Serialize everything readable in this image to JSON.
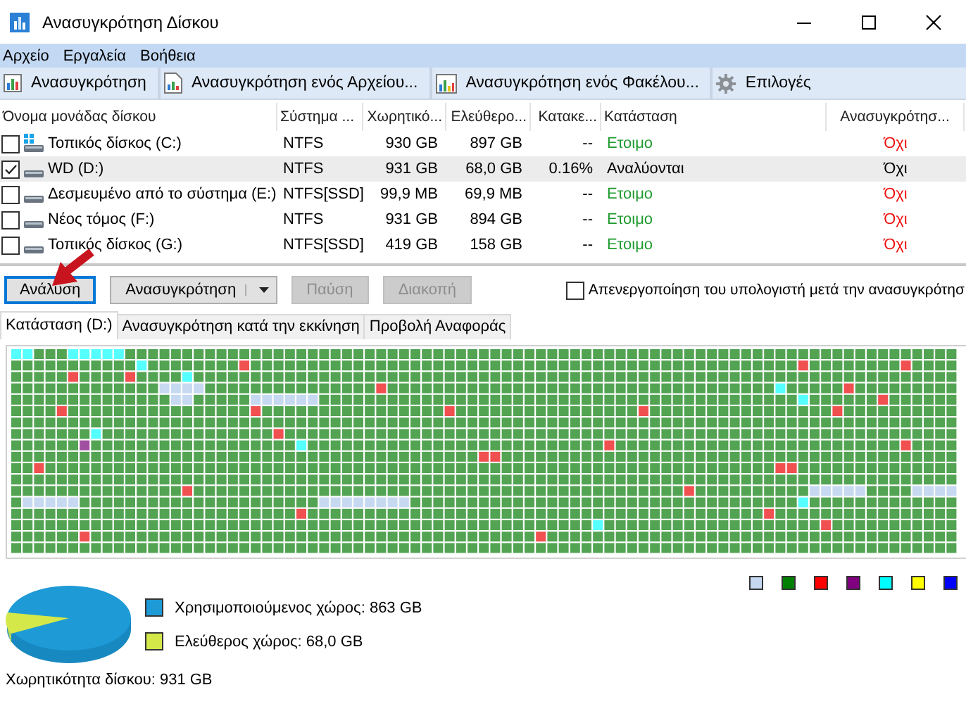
{
  "window": {
    "title": "Ανασυγκρότηση Δίσκου"
  },
  "menu": [
    "Αρχείο",
    "Εργαλεία",
    "Βοήθεια"
  ],
  "toolbar": [
    {
      "label": "Ανασυγκρότηση",
      "kind": "defrag"
    },
    {
      "label": "Ανασυγκρότηση ενός Αρχείου...",
      "kind": "file"
    },
    {
      "label": "Ανασυγκρότηση ενός Φακέλου...",
      "kind": "folder"
    },
    {
      "label": "Επιλογές",
      "kind": "options"
    }
  ],
  "drive_table": {
    "columns": [
      "Όνομα μονάδας δίσκου",
      "Σύστημα ...",
      "Χωρητικό...",
      "Ελεύθερο...",
      "Κατακε...",
      "Κατάσταση",
      "Ανασυγκρότησ..."
    ],
    "rows": [
      {
        "name": "Τοπικός δίσκος (C:)",
        "kind": "system",
        "checked": false,
        "selected": false,
        "file_system": "NTFS",
        "capacity": "930 GB",
        "free": "897 GB",
        "fragmented": "--",
        "status": {
          "text": "Ετοιμο",
          "kind": "ready"
        },
        "defrag": "Όχι"
      },
      {
        "name": "WD (D:)",
        "kind": "drive",
        "checked": true,
        "selected": true,
        "file_system": "NTFS",
        "capacity": "931 GB",
        "free": "68,0 GB",
        "fragmented": "0.16%",
        "status": {
          "text": "Αναλύονται",
          "kind": "busy"
        },
        "defrag": "Όχι"
      },
      {
        "name": "Δεσμευμένο από το σύστημα (E:)",
        "kind": "drive",
        "checked": false,
        "selected": false,
        "file_system": "NTFS[SSD]",
        "capacity": "99,9 MB",
        "free": "69,9 MB",
        "fragmented": "--",
        "status": {
          "text": "Ετοιμο",
          "kind": "ready"
        },
        "defrag": "Όχι"
      },
      {
        "name": "Νέος τόμος (F:)",
        "kind": "drive",
        "checked": false,
        "selected": false,
        "file_system": "NTFS",
        "capacity": "931 GB",
        "free": "894 GB",
        "fragmented": "--",
        "status": {
          "text": "Ετοιμο",
          "kind": "ready"
        },
        "defrag": "Όχι"
      },
      {
        "name": "Τοπικός δίσκος (G:)",
        "kind": "drive",
        "checked": false,
        "selected": false,
        "file_system": "NTFS[SSD]",
        "capacity": "419 GB",
        "free": "158 GB",
        "fragmented": "--",
        "status": {
          "text": "Ετοιμο",
          "kind": "ready"
        },
        "defrag": "Όχι"
      }
    ]
  },
  "actions": {
    "buttons": [
      {
        "label": "Ανάλυση",
        "focused": true,
        "disabled": false,
        "dropdown": false
      },
      {
        "label": "Ανασυγκρότηση",
        "focused": false,
        "disabled": false,
        "dropdown": true
      },
      {
        "label": "Παύση",
        "focused": false,
        "disabled": true,
        "dropdown": false
      },
      {
        "label": "Διακοπή",
        "focused": false,
        "disabled": true,
        "dropdown": false
      }
    ],
    "shutdown_option": {
      "label": "Απενεργοποίηση του υπολογιστή μετά την ανασυγκρότησ",
      "checked": false
    }
  },
  "tabs": [
    {
      "label": "Κατάσταση (D:)",
      "selected": true
    },
    {
      "label": "Ανασυγκρότηση κατά την εκκίνηση",
      "selected": false
    },
    {
      "label": "Προβολή Αναφοράς",
      "selected": false
    }
  ],
  "cluster_legend": [
    {
      "color": "#c6d9f1"
    },
    {
      "color": "#008000"
    },
    {
      "color": "#ff0000"
    },
    {
      "color": "#800080"
    },
    {
      "color": "#00ffff"
    },
    {
      "color": "#ffff00"
    },
    {
      "color": "#0000ff"
    }
  ],
  "summary": {
    "used": {
      "label": "Χρησιμοποιούμενος χώρος: 863 GB",
      "color": "#1e9ad6"
    },
    "free": {
      "label": "Ελεύθερος χώρος: 68,0 GB",
      "color": "#d4e84a"
    },
    "capacity": "Χωρητικότητα δίσκου: 931 GB"
  }
}
